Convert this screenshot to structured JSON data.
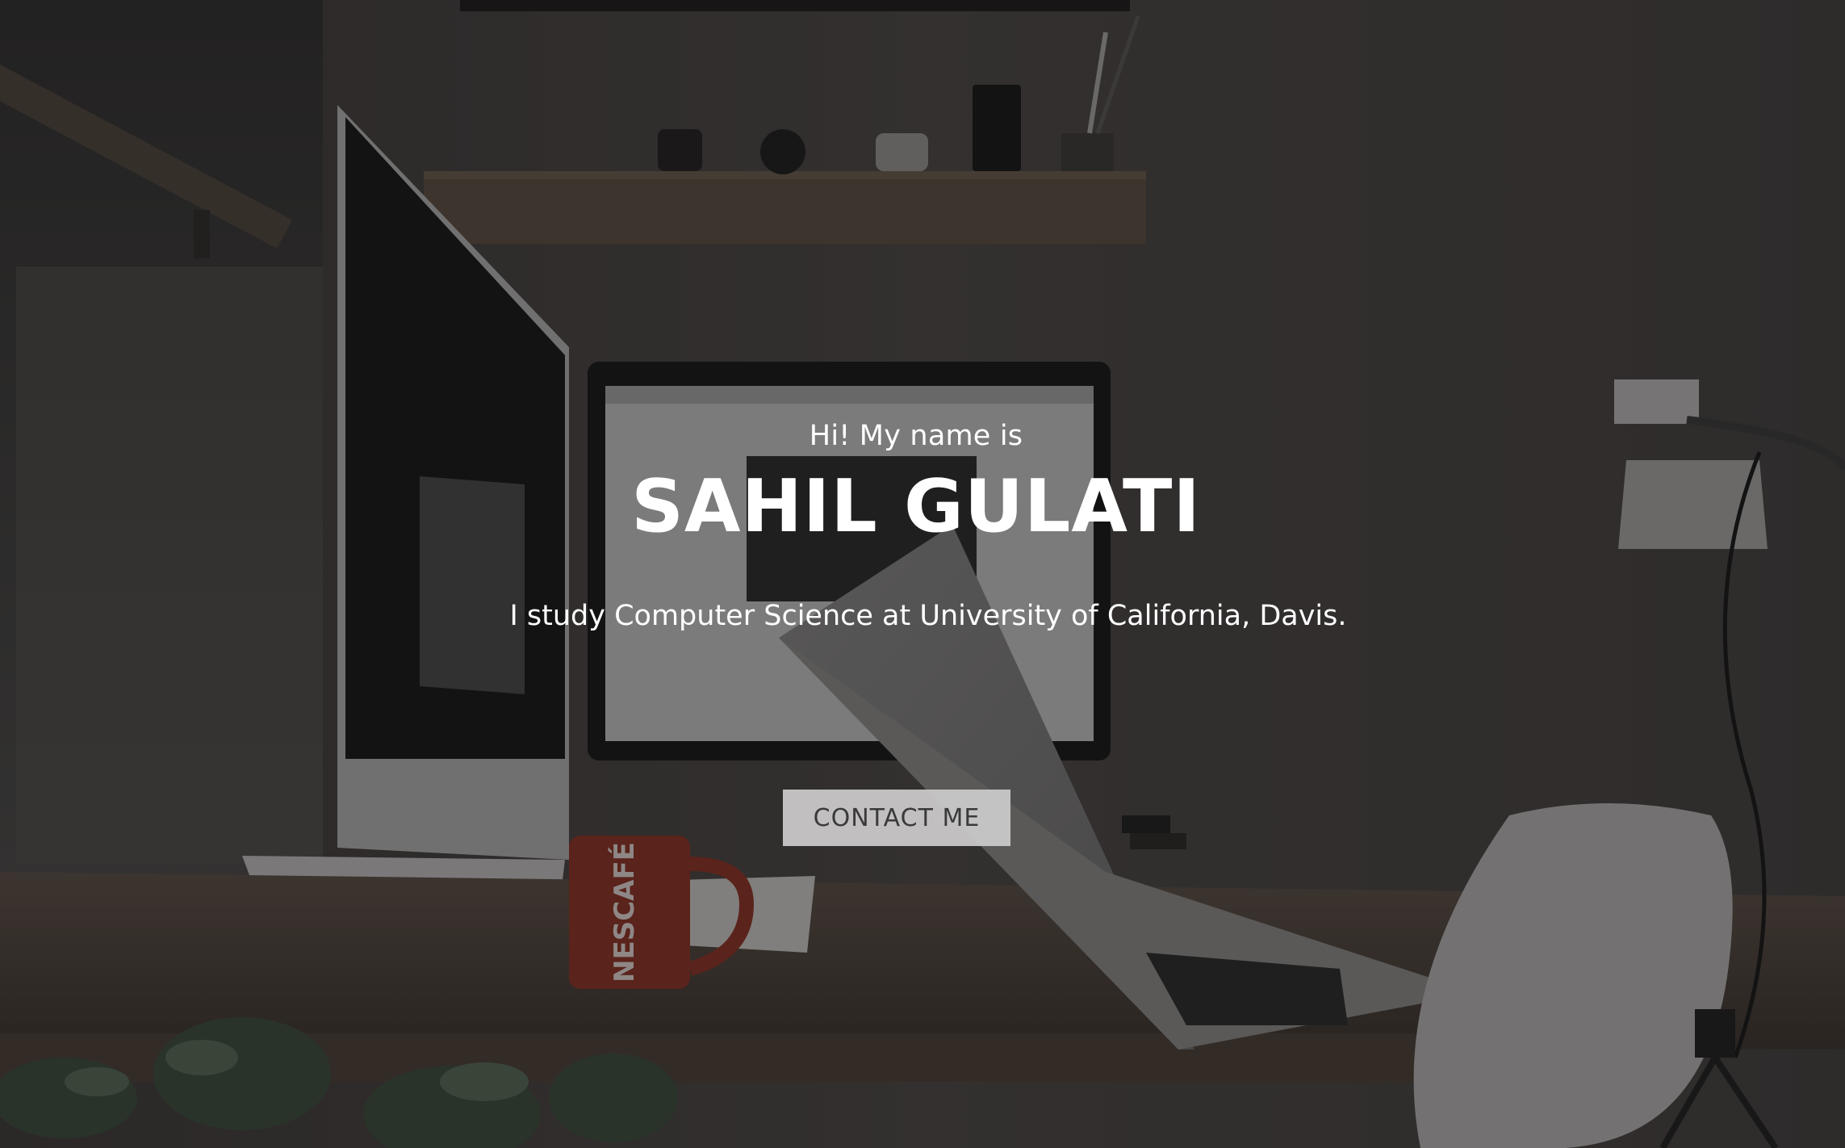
{
  "hero": {
    "greeting": "Hi! My name is",
    "name": "SAHIL GULATI",
    "tagline": "I study Computer Science at University of California, Davis.",
    "contact_label": "CONTACT ME",
    "mug_brand": "NESCAFÉ"
  },
  "colors": {
    "text": "#ffffff",
    "button_bg": "#cdcccc",
    "button_text": "#3a3a3a",
    "overlay": "#141212",
    "mug": "#a8392b"
  },
  "background": {
    "scene": "desk-workspace-photo"
  }
}
